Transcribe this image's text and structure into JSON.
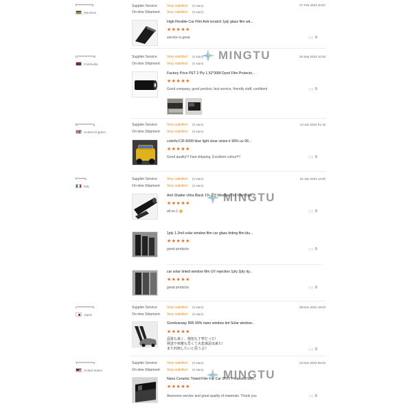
{
  "labels": {
    "supplier": "Supplier Service:",
    "ontime": "On-time Shipment:"
  },
  "colors": {
    "accent": "#f08a18",
    "star": "#f06a1f"
  },
  "watermark": {
    "text": "MINGTU",
    "icon": "star-logo-icon"
  },
  "reviews": [
    {
      "user": "f*************n",
      "country": "Mauritius",
      "supplier_value": "Very satisfied",
      "supplier_stars": "(5 stars)",
      "ontime_value": "Very satisfied",
      "ontime_stars": "(5 stars)",
      "date": "27 Feb 2024 20:57",
      "products": [
        {
          "title": "High Flexible Car Film Anti-scratch 1ply glass film wit...",
          "rating": 5,
          "comment": "service is great",
          "likes": "0"
        }
      ]
    },
    {
      "user": "C*************S",
      "country": "Cambodia",
      "supplier_value": "Very satisfied",
      "supplier_stars": "(5 stars)",
      "ontime_value": "Very satisfied",
      "ontime_stars": "(5 stars)",
      "date": "25 Sep 2023 10:48",
      "products": [
        {
          "title": "Factory Price PET 2 Ply 1.52*30M Dyed Film Protecto...",
          "rating": 5,
          "comment": "Good company, good product, fast service, friendly staff, confident",
          "likes": "0"
        }
      ]
    },
    {
      "user": "D*************y",
      "country": "United Kingdom",
      "supplier_value": "Very satisfied",
      "supplier_stars": "(5 stars)",
      "ontime_value": "Very satisfied",
      "ontime_stars": "(5 stars)",
      "date": "13 Jan 2024 01:15",
      "products": [
        {
          "title": "colorful CR-6099 blue light clear vision ir 99% uv 99...",
          "rating": 5,
          "comment": "Good quality!!! Fast shipping. Excellent colour!!!!",
          "likes": "0"
        }
      ]
    },
    {
      "user": "f*******s",
      "country": "Italy",
      "supplier_value": "Very satisfied",
      "supplier_stars": "(5 stars)",
      "ontime_value": "Very satisfied",
      "ontime_stars": "(5 stars)",
      "date": "22 Jan 2024 13:20",
      "products": [
        {
          "title": "Anti Shatter Ultra Black 1% 2*3 Window Tint Film Blac...",
          "rating": 5,
          "comment": "all no.1",
          "likes": "0"
        },
        {
          "title": "1ply 1.2mil solar window film car glass tinting film blu...",
          "rating": 5,
          "comment": "great products",
          "likes": "0"
        },
        {
          "title": "car solar tinted window film UV rejection 1ply 2ply dy...",
          "rating": 5,
          "comment": "great products",
          "likes": "0"
        }
      ]
    },
    {
      "user": "c*************s",
      "country": "Japan",
      "supplier_value": "Very satisfied",
      "supplier_stars": "(5 stars)",
      "ontime_value": "Very satisfied",
      "ontime_stars": "(5 stars)",
      "date": "09 Nov 2022 19:03",
      "products": [
        {
          "title": "Goodcarway IRR 99% nano window tint Solar window...",
          "rating": 5,
          "comment": "品質も良く、梱包も丁寧だった!",
          "comment2": "発送や到着も早くて大変満足出来た!",
          "comment3": "また利用したいと思うよ!!",
          "likes": "0"
        }
      ]
    },
    {
      "user": "Y*************o",
      "country": "United States",
      "supplier_value": "Very satisfied",
      "supplier_stars": "(5 stars)",
      "ontime_value": "Very satisfied",
      "ontime_stars": "(5 stars)",
      "date": "24 Nov 2023 08:34",
      "products": [
        {
          "title": "Nano Ceramic Tinted Film For Car 2PLY Polarized Win...",
          "rating": 5,
          "comment": "Awesome service and great quality of materials. Thank you",
          "likes": "0"
        }
      ]
    }
  ]
}
